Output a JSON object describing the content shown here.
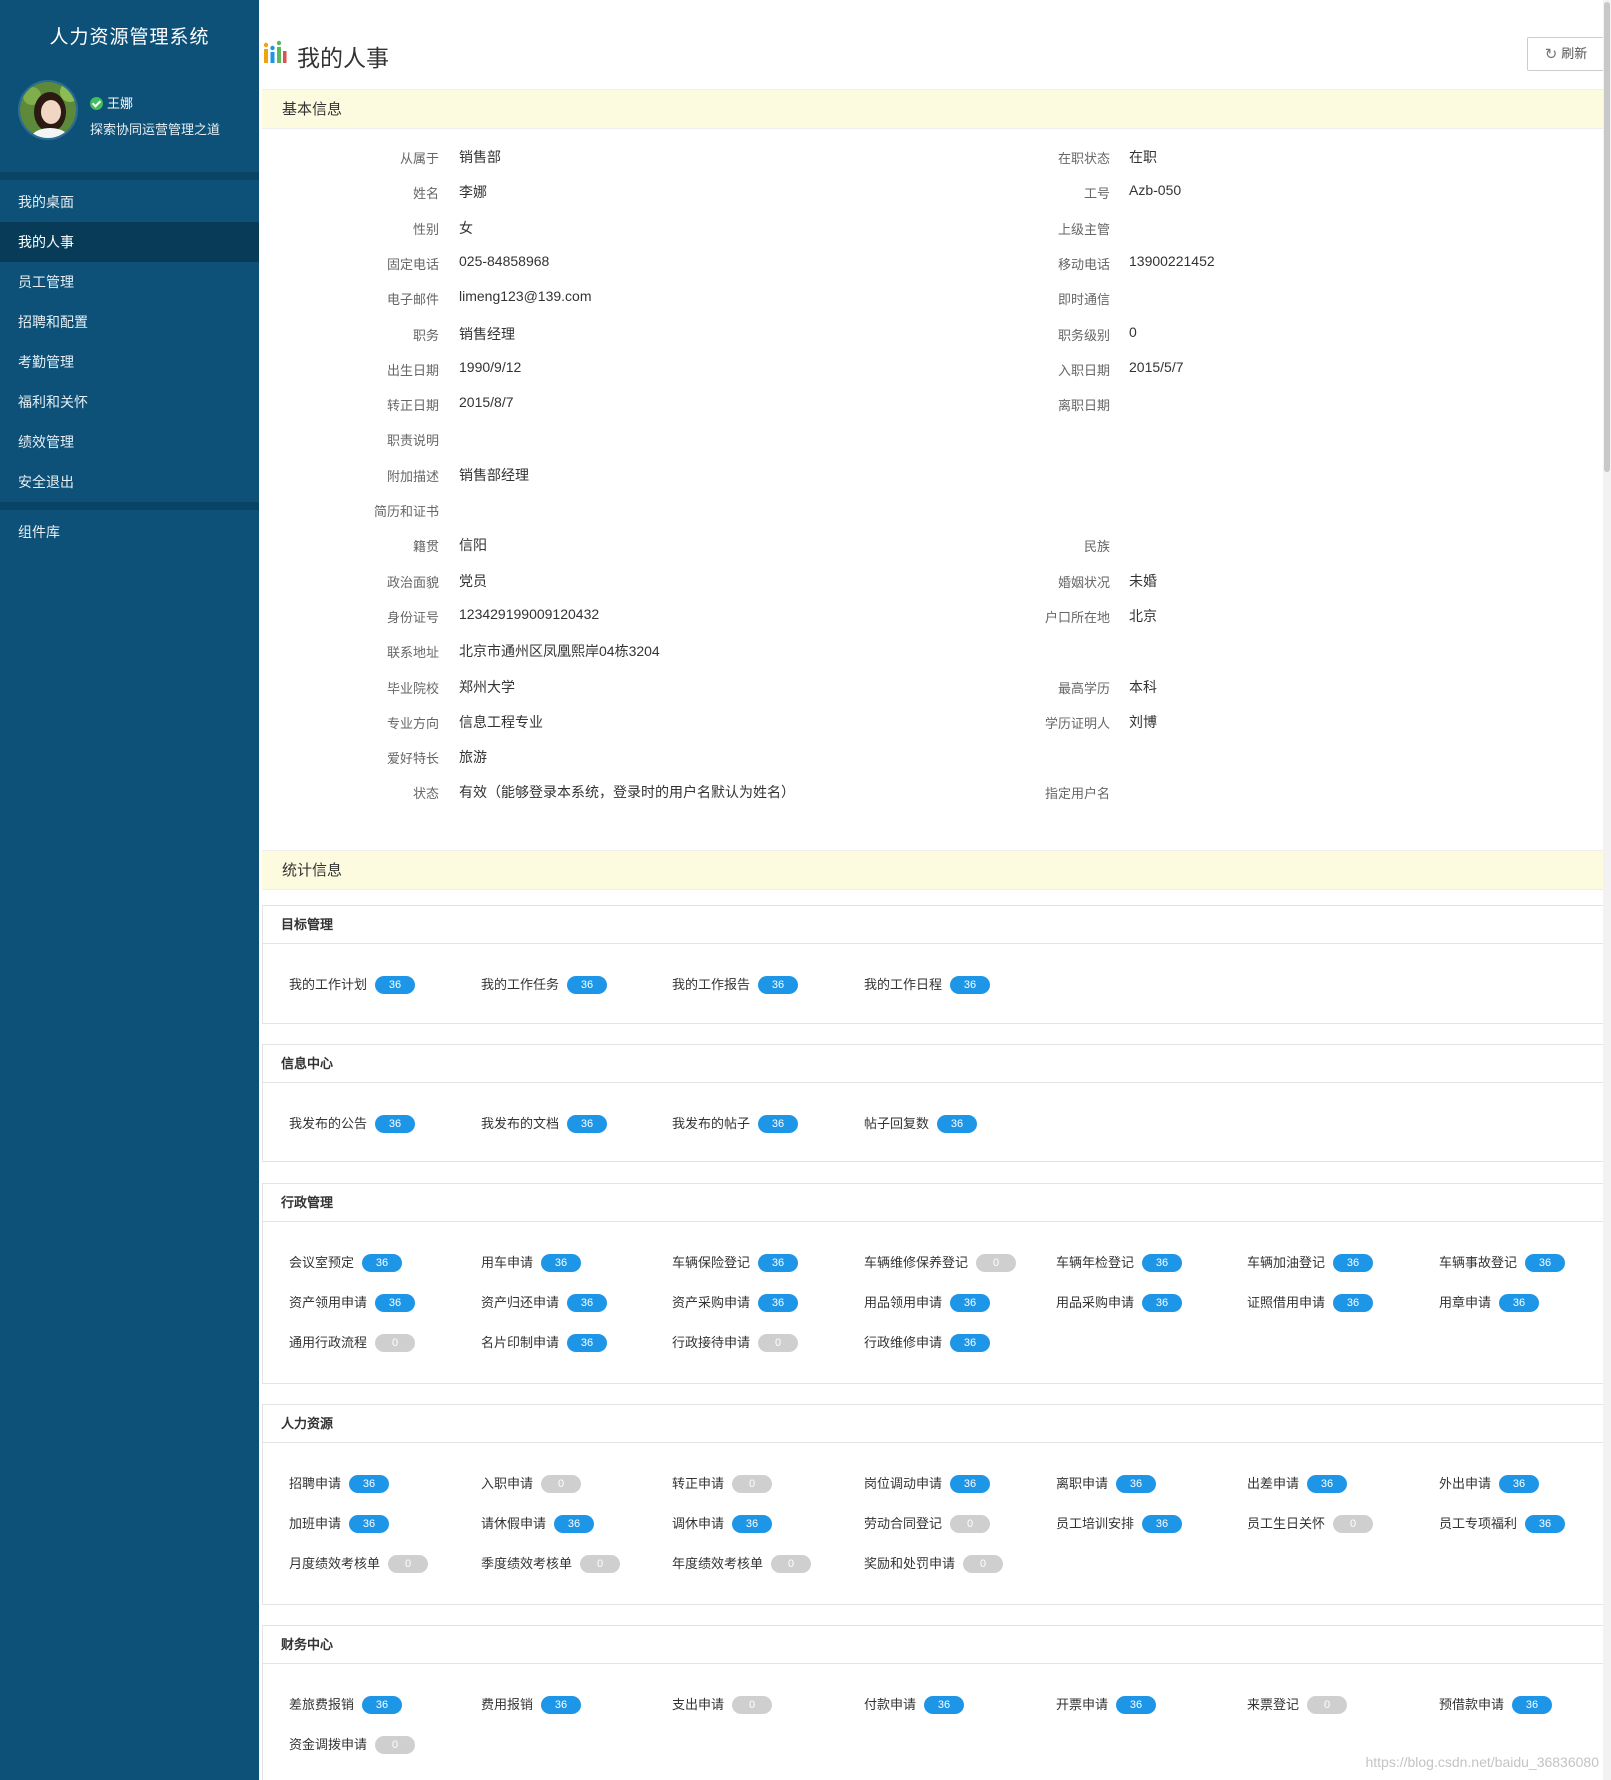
{
  "app": {
    "title": "人力资源管理系统"
  },
  "user": {
    "name": "王娜",
    "motto": "探索协同运营管理之道"
  },
  "nav": {
    "items": [
      "我的桌面",
      "我的人事",
      "员工管理",
      "招聘和配置",
      "考勤管理",
      "福利和关怀",
      "绩效管理",
      "安全退出"
    ],
    "active": "我的人事",
    "extra": "组件库"
  },
  "header": {
    "title": "我的人事",
    "refresh_label": "刷新"
  },
  "basic": {
    "section_title": "基本信息",
    "rows": [
      {
        "l1": "从属于",
        "v1": "销售部",
        "l2": "在职状态",
        "v2": "在职"
      },
      {
        "l1": "姓名",
        "v1": "李娜",
        "l2": "工号",
        "v2": "Azb-050"
      },
      {
        "l1": "性别",
        "v1": "女",
        "l2": "上级主管",
        "v2": ""
      },
      {
        "l1": "固定电话",
        "v1": "025-84858968",
        "l2": "移动电话",
        "v2": "13900221452"
      },
      {
        "l1": "电子邮件",
        "v1": "limeng123@139.com",
        "l2": "即时通信",
        "v2": ""
      },
      {
        "l1": "职务",
        "v1": "销售经理",
        "l2": "职务级别",
        "v2": "0"
      },
      {
        "l1": "出生日期",
        "v1": "1990/9/12",
        "l2": "入职日期",
        "v2": "2015/5/7"
      },
      {
        "l1": "转正日期",
        "v1": "2015/8/7",
        "l2": "离职日期",
        "v2": ""
      },
      {
        "l1": "职责说明",
        "v1": "",
        "l2": "",
        "v2": ""
      },
      {
        "l1": "附加描述",
        "v1": "销售部经理",
        "l2": "",
        "v2": ""
      },
      {
        "l1": "简历和证书",
        "v1": "",
        "l2": "",
        "v2": ""
      },
      {
        "l1": "籍贯",
        "v1": "信阳",
        "l2": "民族",
        "v2": ""
      },
      {
        "l1": "政治面貌",
        "v1": "党员",
        "l2": "婚姻状况",
        "v2": "未婚"
      },
      {
        "l1": "身份证号",
        "v1": "123429199009120432",
        "l2": "户口所在地",
        "v2": "北京"
      },
      {
        "l1": "联系地址",
        "v1": "北京市通州区凤凰熙岸04栋3204",
        "l2": "",
        "v2": ""
      },
      {
        "l1": "毕业院校",
        "v1": "郑州大学",
        "l2": "最高学历",
        "v2": "本科"
      },
      {
        "l1": "专业方向",
        "v1": "信息工程专业",
        "l2": "学历证明人",
        "v2": "刘博"
      },
      {
        "l1": "爱好特长",
        "v1": "旅游",
        "l2": "",
        "v2": ""
      },
      {
        "l1": "状态",
        "v1": "有效（能够登录本系统，登录时的用户名默认为姓名）",
        "l2": "指定用户名",
        "v2": ""
      }
    ]
  },
  "stats": {
    "section_title": "统计信息",
    "cards": [
      {
        "title": "目标管理",
        "items": [
          {
            "label": "我的工作计划",
            "count": "36"
          },
          {
            "label": "我的工作任务",
            "count": "36"
          },
          {
            "label": "我的工作报告",
            "count": "36"
          },
          {
            "label": "我的工作日程",
            "count": "36"
          }
        ]
      },
      {
        "title": "信息中心",
        "items": [
          {
            "label": "我发布的公告",
            "count": "36"
          },
          {
            "label": "我发布的文档",
            "count": "36"
          },
          {
            "label": "我发布的帖子",
            "count": "36"
          },
          {
            "label": "帖子回复数",
            "count": "36"
          }
        ]
      },
      {
        "title": "行政管理",
        "items": [
          {
            "label": "会议室预定",
            "count": "36"
          },
          {
            "label": "用车申请",
            "count": "36"
          },
          {
            "label": "车辆保险登记",
            "count": "36"
          },
          {
            "label": "车辆维修保养登记",
            "count": "0"
          },
          {
            "label": "车辆年检登记",
            "count": "36"
          },
          {
            "label": "车辆加油登记",
            "count": "36"
          },
          {
            "label": "车辆事故登记",
            "count": "36"
          },
          {
            "label": "资产领用申请",
            "count": "36"
          },
          {
            "label": "资产归还申请",
            "count": "36"
          },
          {
            "label": "资产采购申请",
            "count": "36"
          },
          {
            "label": "用品领用申请",
            "count": "36"
          },
          {
            "label": "用品采购申请",
            "count": "36"
          },
          {
            "label": "证照借用申请",
            "count": "36"
          },
          {
            "label": "用章申请",
            "count": "36"
          },
          {
            "label": "通用行政流程",
            "count": "0"
          },
          {
            "label": "名片印制申请",
            "count": "36"
          },
          {
            "label": "行政接待申请",
            "count": "0"
          },
          {
            "label": "行政维修申请",
            "count": "36"
          }
        ]
      },
      {
        "title": "人力资源",
        "items": [
          {
            "label": "招聘申请",
            "count": "36"
          },
          {
            "label": "入职申请",
            "count": "0"
          },
          {
            "label": "转正申请",
            "count": "0"
          },
          {
            "label": "岗位调动申请",
            "count": "36"
          },
          {
            "label": "离职申请",
            "count": "36"
          },
          {
            "label": "出差申请",
            "count": "36"
          },
          {
            "label": "外出申请",
            "count": "36"
          },
          {
            "label": "加班申请",
            "count": "36"
          },
          {
            "label": "请休假申请",
            "count": "36"
          },
          {
            "label": "调休申请",
            "count": "36"
          },
          {
            "label": "劳动合同登记",
            "count": "0"
          },
          {
            "label": "员工培训安排",
            "count": "36"
          },
          {
            "label": "员工生日关怀",
            "count": "0"
          },
          {
            "label": "员工专项福利",
            "count": "36"
          },
          {
            "label": "月度绩效考核单",
            "count": "0"
          },
          {
            "label": "季度绩效考核单",
            "count": "0"
          },
          {
            "label": "年度绩效考核单",
            "count": "0"
          },
          {
            "label": "奖励和处罚申请",
            "count": "0"
          }
        ]
      },
      {
        "title": "财务中心",
        "items": [
          {
            "label": "差旅费报销",
            "count": "36"
          },
          {
            "label": "费用报销",
            "count": "36"
          },
          {
            "label": "支出申请",
            "count": "0"
          },
          {
            "label": "付款申请",
            "count": "36"
          },
          {
            "label": "开票申请",
            "count": "36"
          },
          {
            "label": "来票登记",
            "count": "0"
          },
          {
            "label": "预借款申请",
            "count": "36"
          },
          {
            "label": "资金调拨申请",
            "count": "0"
          }
        ]
      }
    ]
  },
  "colors": {
    "sidebar": "#0e5178",
    "badge": "#1e96e8",
    "badge_zero": "#cfcfcf",
    "section_bg": "#fdfbdf"
  },
  "watermark": "https://blog.csdn.net/baidu_36836080"
}
